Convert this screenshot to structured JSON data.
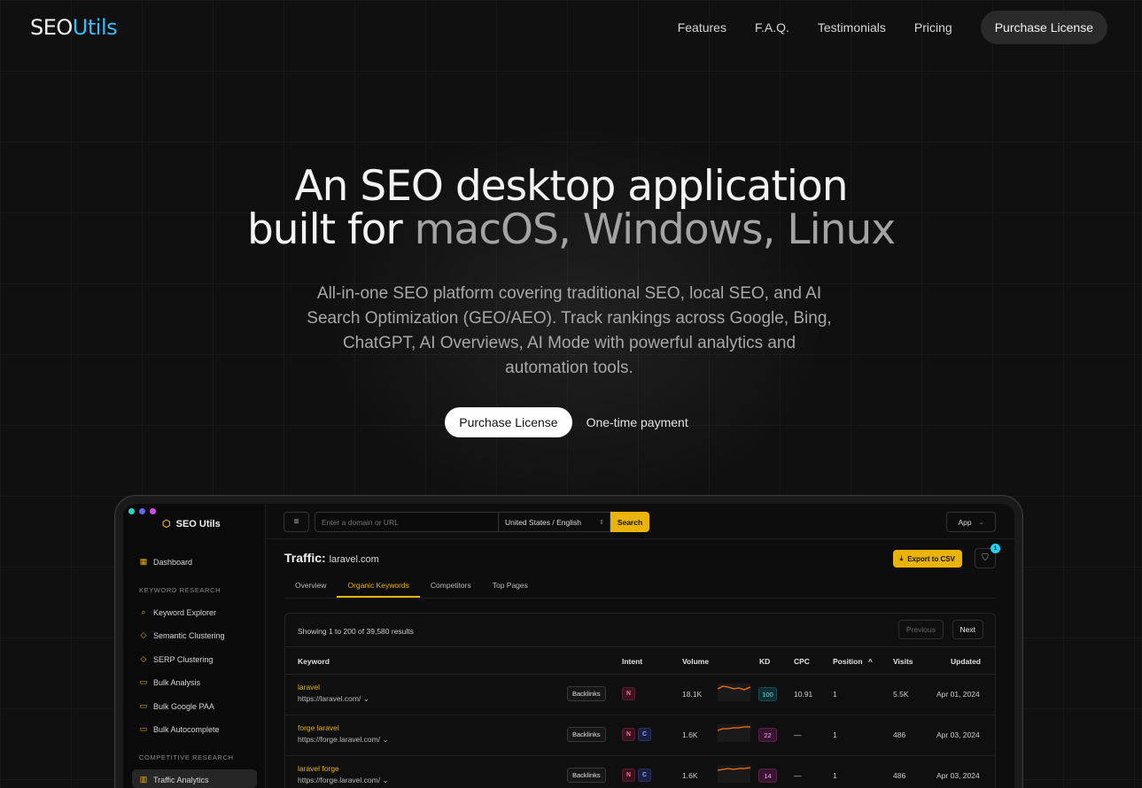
{
  "nav": {
    "logo_a": "SEO",
    "logo_b": "Utils",
    "links": [
      "Features",
      "F.A.Q.",
      "Testimonials",
      "Pricing"
    ],
    "cta": "Purchase License"
  },
  "hero": {
    "title_line1": "An SEO desktop application",
    "title_line2_a": "built for ",
    "title_line2_b": "macOS, Windows, Linux",
    "subtitle": "All-in-one SEO platform covering traditional SEO, local SEO, and AI Search Optimization (GEO/AEO). Track rankings across Google, Bing, ChatGPT, AI Overviews, AI Mode with powerful analytics and automation tools.",
    "cta_primary": "Purchase License",
    "cta_note": "One-time payment"
  },
  "app": {
    "brand": "SEO Utils",
    "sidebar": {
      "dashboard": "Dashboard",
      "section_keyword": "KEYWORD RESEARCH",
      "keyword_items": [
        "Keyword Explorer",
        "Semantic Clustering",
        "SERP Clustering",
        "Bulk Analysis",
        "Bulk Google PAA",
        "Bulk Autocomplete"
      ],
      "section_competitive": "COMPETITIVE RESEARCH",
      "competitive_items": [
        "Traffic Analytics"
      ]
    },
    "topbar": {
      "url_placeholder": "Enter a domain or URL",
      "locale": "United States / English",
      "search": "Search",
      "app_menu": "App"
    },
    "page": {
      "title_prefix": "Traffic:",
      "domain": "laravel.com",
      "export": "Export to CSV",
      "filter_count": "1",
      "tabs": [
        "Overview",
        "Organic Keywords",
        "Competitors",
        "Top Pages"
      ],
      "active_tab": 1
    },
    "table": {
      "showing": "Showing 1 to 200 of 39,580 results",
      "prev": "Previous",
      "next": "Next",
      "headers": {
        "keyword": "Keyword",
        "intent": "Intent",
        "volume": "Volume",
        "kd": "KD",
        "cpc": "CPC",
        "position": "Position",
        "visits": "Visits",
        "updated": "Updated"
      },
      "backlinks_label": "Backlinks",
      "rows": [
        {
          "keyword": "laravel",
          "url": "https://laravel.com/",
          "intent": [
            "N"
          ],
          "volume": "18.1K",
          "kd": "100",
          "cpc": "10.91",
          "position": "1",
          "visits": "5.5K",
          "updated": "Apr 01, 2024"
        },
        {
          "keyword": "forge laravel",
          "url": "https://forge.laravel.com/",
          "intent": [
            "N",
            "C"
          ],
          "volume": "1.6K",
          "kd": "22",
          "cpc": "—",
          "position": "1",
          "visits": "486",
          "updated": "Apr 03, 2024"
        },
        {
          "keyword": "laravel forge",
          "url": "https://forge.laravel.com/",
          "intent": [
            "N",
            "C"
          ],
          "volume": "1.6K",
          "kd": "14",
          "cpc": "—",
          "position": "1",
          "visits": "486",
          "updated": "Apr 03, 2024"
        }
      ]
    }
  },
  "colors": {
    "accent": "#eab308",
    "brand_blue": "#38bdf8",
    "dot_1": "#2dd4bf",
    "dot_2": "#6366f1",
    "dot_3": "#d946ef"
  },
  "icons": {
    "brand": "hexagon-logo-icon",
    "dashboard": "dashboard-icon",
    "search": "search-icon",
    "tag": "tag-icon",
    "folder": "folder-icon",
    "chart": "bar-chart-icon",
    "menu": "menu-icon",
    "download": "download-icon",
    "filter": "filter-icon",
    "sort": "sort-up-icon"
  }
}
